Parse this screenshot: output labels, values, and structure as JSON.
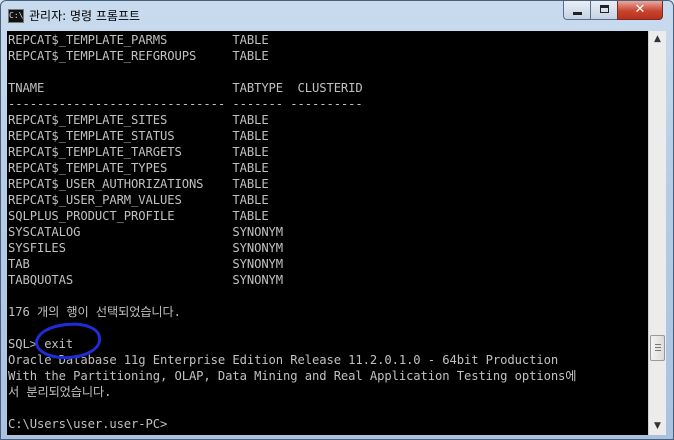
{
  "window": {
    "title": "관리자: 명령 프롬프트",
    "icon": "cmd-icon",
    "controls": {
      "minimize": "minimize",
      "maximize": "maximize",
      "close": "✕"
    }
  },
  "console": {
    "lines": [
      "REPCAT$_TEMPLATE_PARMS         TABLE",
      "REPCAT$_TEMPLATE_REFGROUPS     TABLE",
      "",
      "TNAME                          TABTYPE  CLUSTERID",
      "------------------------------ ------- ----------",
      "REPCAT$_TEMPLATE_SITES         TABLE",
      "REPCAT$_TEMPLATE_STATUS        TABLE",
      "REPCAT$_TEMPLATE_TARGETS       TABLE",
      "REPCAT$_TEMPLATE_TYPES         TABLE",
      "REPCAT$_USER_AUTHORIZATIONS    TABLE",
      "REPCAT$_USER_PARM_VALUES       TABLE",
      "SQLPLUS_PRODUCT_PROFILE        TABLE",
      "SYSCATALOG                     SYNONYM",
      "SYSFILES                       SYNONYM",
      "TAB                            SYNONYM",
      "TABQUOTAS                      SYNONYM",
      "",
      "176 개의 행이 선택되었습니다.",
      "",
      "SQL> exit",
      "Oracle Database 11g Enterprise Edition Release 11.2.0.1.0 - 64bit Production",
      "With the Partitioning, OLAP, Data Mining and Real Application Testing options에",
      "서 분리되었습니다.",
      "",
      "C:\\Users\\user.user-PC>"
    ]
  },
  "scrollbar": {
    "up": "▲",
    "down": "▼"
  },
  "colors": {
    "console_bg": "#000000",
    "console_text": "#c0c0c0",
    "annotation": "#1f2dd8",
    "close_button": "#c8442f"
  }
}
